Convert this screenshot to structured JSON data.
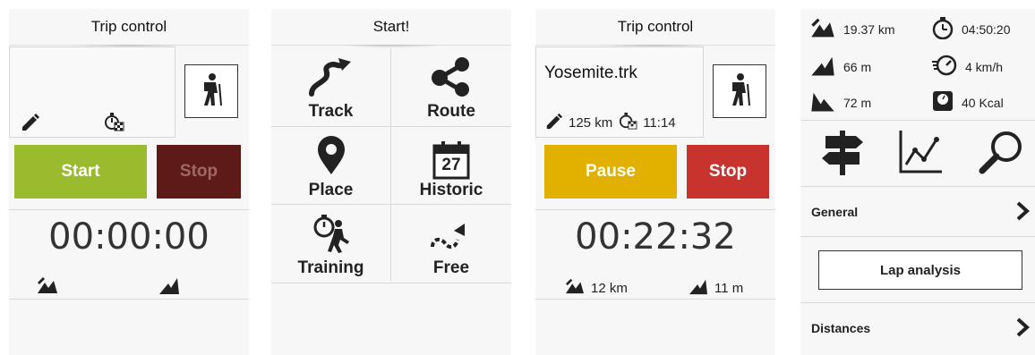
{
  "colors": {
    "start_green": "#9bbb2f",
    "stop_dark_red": "#5e1a16",
    "stop_dim_text": "#9c6a66",
    "pause_yellow": "#e2b100",
    "stop_red": "#c8332e"
  },
  "screen1": {
    "title": "Trip control",
    "start_label": "Start",
    "stop_label": "Stop",
    "timer": "00:00:00",
    "icons": [
      "pencil-icon",
      "stopwatch-flag-icon",
      "hiker-icon",
      "distance-icon",
      "ascent-icon"
    ]
  },
  "screen2": {
    "title": "Start!",
    "items": [
      {
        "label": "Track",
        "icon": "track-arrow-icon"
      },
      {
        "label": "Route",
        "icon": "share-nodes-icon"
      },
      {
        "label": "Place",
        "icon": "map-pin-icon"
      },
      {
        "label": "Historic",
        "icon": "calendar-icon",
        "calendar_day": "27"
      },
      {
        "label": "Training",
        "icon": "stopwatch-runner-icon"
      },
      {
        "label": "Free",
        "icon": "free-path-icon"
      }
    ]
  },
  "screen3": {
    "title": "Trip control",
    "track_name": "Yosemite.trk",
    "distance_total": "125 km",
    "time_estimate": "11:14",
    "pause_label": "Pause",
    "stop_label": "Stop",
    "timer": "00:22:32",
    "distance": "12 km",
    "ascent": "11 m"
  },
  "screen4": {
    "stats": {
      "distance": "19.37 km",
      "time": "04:50:20",
      "ascent": "66 m",
      "speed": "4 km/h",
      "descent": "72 m",
      "calories": "40 Kcal"
    },
    "tools": [
      "signpost-icon",
      "chart-icon",
      "magnifier-icon"
    ],
    "general_label": "General",
    "lap_label": "Lap analysis",
    "distances_label": "Distances"
  }
}
